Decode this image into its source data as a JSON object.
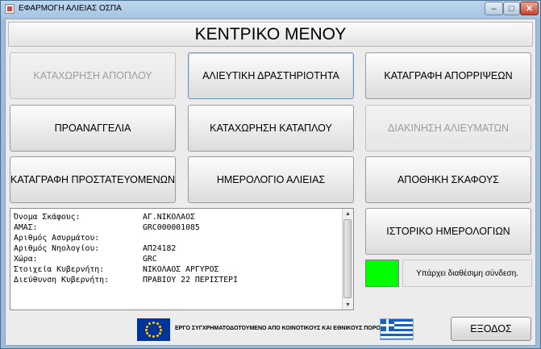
{
  "window": {
    "title": "ΕΦΑΡΜΟΓΗ ΑΛΙΕΙΑΣ ΟΣΠΑ",
    "controls": {
      "minimize": "–",
      "maximize": "□",
      "close": "✕"
    }
  },
  "header": {
    "title": "ΚΕΝΤΡΙΚΟ ΜΕΝΟΥ"
  },
  "menu": {
    "row1": [
      "ΚΑΤΑΧΩΡΗΣΗ ΑΠΟΠΛΟΥ",
      "ΑΛΙΕΥΤΙΚΗ ΔΡΑΣΤΗΡΙΟΤΗΤΑ",
      "ΚΑΤΑΓΡΑΦΗ ΑΠΟΡΡΙΨΕΩΝ"
    ],
    "row2": [
      "ΠΡΟΑΝΑΓΓΕΛΙΑ",
      "ΚΑΤΑΧΩΡΗΣΗ ΚΑΤΑΠΛΟΥ",
      "ΔΙΑΚΙΝΗΣΗ ΑΛΙΕΥΜΑΤΩΝ"
    ],
    "row3": [
      "ΚΑΤΑΓΡΑΦΗ ΠΡΟΣΤΑΤΕΥΟΜΕΝΩΝ",
      "ΗΜΕΡΟΛΟΓΙΟ ΑΛΙΕΙΑΣ",
      "ΑΠΟΘΗΚΗ ΣΚΑΦΟΥΣ"
    ],
    "history": "ΙΣΤΟΡΙΚΟ ΗΜΕΡΟΛΟΓΙΩΝ"
  },
  "vessel_info": [
    {
      "label": "Όνομα Σκάφους:",
      "value": "ΑΓ.ΝΙΚΟΛΑΟΣ"
    },
    {
      "label": "ΑΜΑΣ:",
      "value": "GRC000001085"
    },
    {
      "label": "Αριθμός Ασυρμάτου:",
      "value": ""
    },
    {
      "label": "Αριθμός Νηολογίου:",
      "value": "ΑΠ24182"
    },
    {
      "label": "Χώρα:",
      "value": "GRC"
    },
    {
      "label": "Στοιχεία Κυβερνήτη:",
      "value": "ΝΙΚΟΛΑΟΣ ΑΡΓΥΡΟΣ"
    },
    {
      "label": "Διεύθυνση Κυβερνήτη:",
      "value": "ΠΡΑΒΙΟΥ 22 ΠΕΡΙΣΤΕΡΙ"
    }
  ],
  "connection": {
    "status_text": "Υπάρχει διαθέσιμη σύνδεση.",
    "indicator_color": "#00ff00"
  },
  "footer": {
    "cofund_text": "ΕΡΓΟ ΣΥΓΧΡΗΜΑΤΟΔΟΤΟΥΜΕΝΟ ΑΠΟ ΚΟΙΝΟΤΙΚΟΥΣ ΚΑΙ ΕΘΝΙΚΟΥΣ ΠΟΡΟΥΣ",
    "exit_label": "ΕΞΟΔΟΣ"
  }
}
